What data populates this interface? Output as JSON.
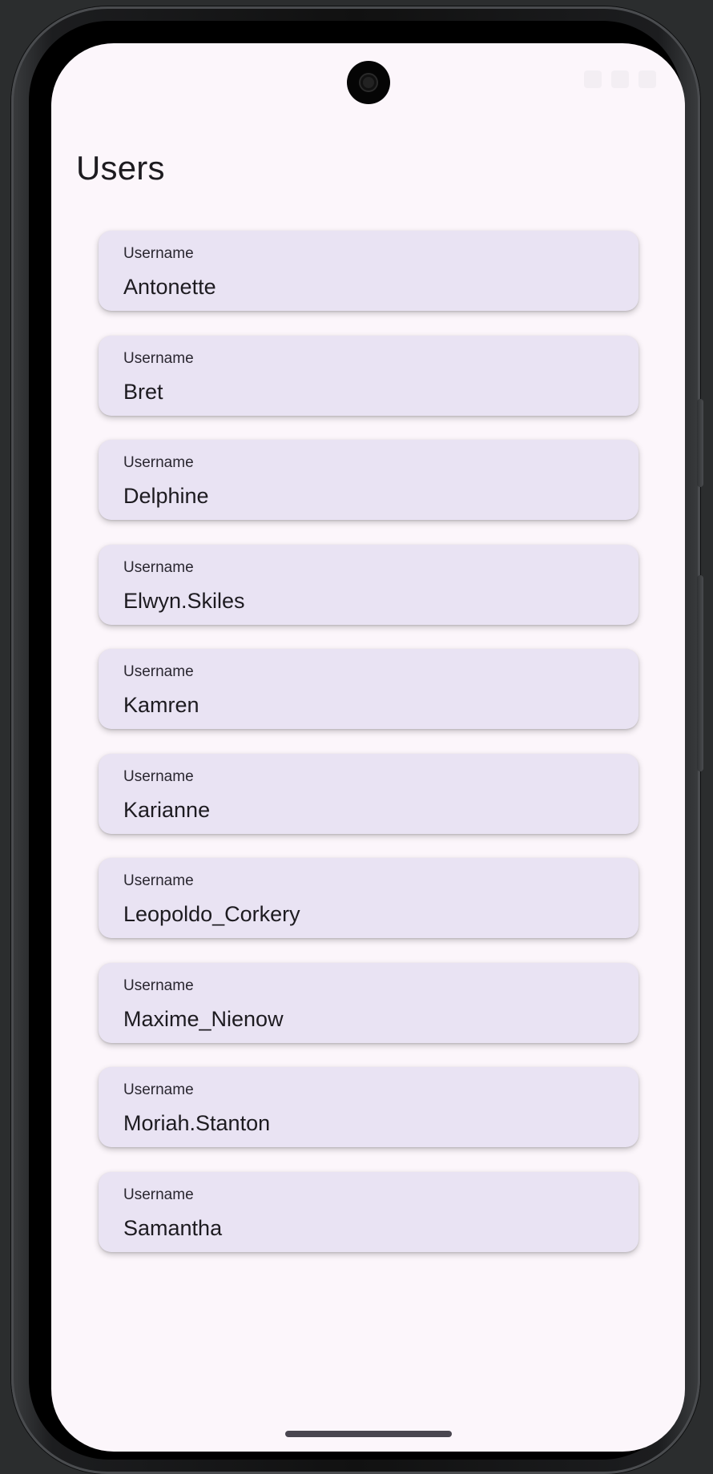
{
  "page": {
    "title": "Users"
  },
  "users": [
    {
      "label": "Username",
      "value": "Antonette"
    },
    {
      "label": "Username",
      "value": "Bret"
    },
    {
      "label": "Username",
      "value": "Delphine"
    },
    {
      "label": "Username",
      "value": "Elwyn.Skiles"
    },
    {
      "label": "Username",
      "value": "Kamren"
    },
    {
      "label": "Username",
      "value": "Karianne"
    },
    {
      "label": "Username",
      "value": "Leopoldo_Corkery"
    },
    {
      "label": "Username",
      "value": "Maxime_Nienow"
    },
    {
      "label": "Username",
      "value": "Moriah.Stanton"
    },
    {
      "label": "Username",
      "value": "Samantha"
    }
  ],
  "icons": {
    "camera": "front-camera-icon",
    "wifi": "wifi-icon",
    "signal": "signal-icon",
    "battery": "battery-icon"
  },
  "colors": {
    "background": "#fcf6fb",
    "card": "#e9e3f3",
    "text": "#1d1b20"
  }
}
